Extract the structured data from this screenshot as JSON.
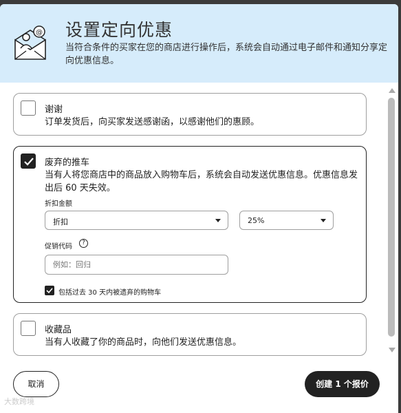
{
  "header": {
    "title": "设置定向优惠",
    "description": "当符合条件的买家在您的商店进行操作后，系统会自动通过电子邮件和通知分享定向优惠信息。"
  },
  "options": [
    {
      "title": "谢谢",
      "description": "订单发货后，向买家发送感谢函，以感谢他们的惠顾。",
      "checked": false
    },
    {
      "title": "废弃的推车",
      "description": "当有人将您商店中的商品放入购物车后，系统会自动发送优惠信息。优惠信息发出后 60 天失效。",
      "checked": true,
      "discount_label": "折扣金额",
      "discount_type": "折扣",
      "discount_value": "25%",
      "promo_label": "促销代码",
      "promo_help": "?",
      "promo_placeholder": "例如：回归",
      "include_label": "包括过去 30 天内被遗弃的购物车",
      "include_checked": true
    },
    {
      "title": "收藏品",
      "description": "当有人收藏了你的商品时，向他们发送优惠信息。",
      "checked": false
    }
  ],
  "footer": {
    "cancel_label": "取消",
    "create_label": "创建 1 个报价"
  },
  "watermark": "大数跨境",
  "colors": {
    "header_bg": "#d6ecfb",
    "primary_button": "#222222"
  }
}
